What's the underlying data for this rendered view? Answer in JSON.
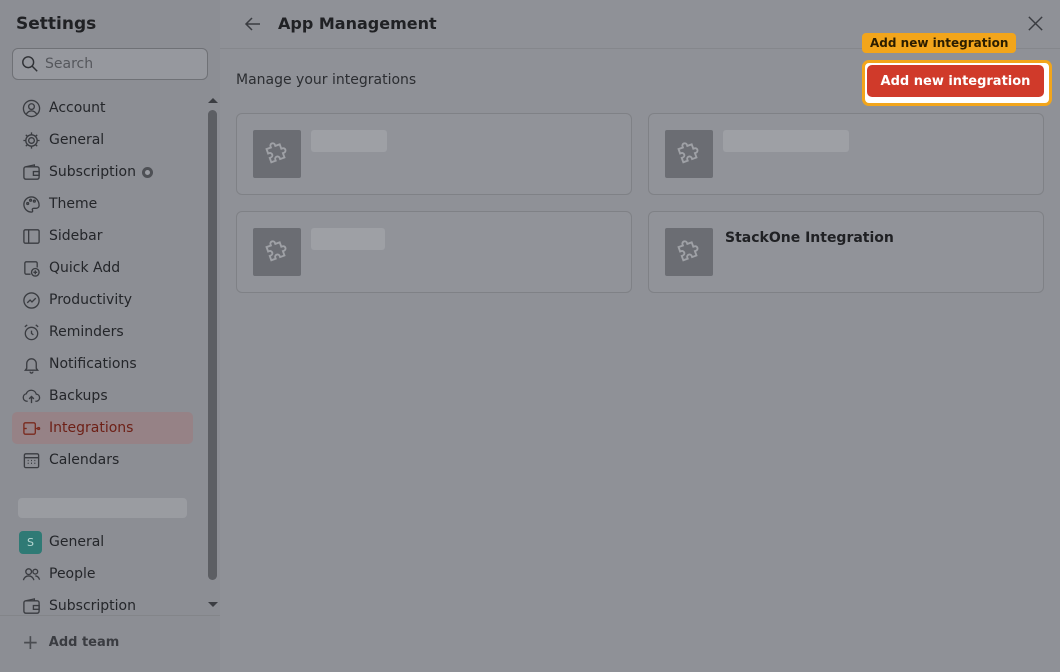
{
  "sidebar": {
    "title": "Settings",
    "search_placeholder": "Search",
    "items": [
      {
        "label": "Account",
        "icon": "user-circle-icon"
      },
      {
        "label": "General",
        "icon": "gear-icon"
      },
      {
        "label": "Subscription",
        "icon": "wallet-icon"
      },
      {
        "label": "Theme",
        "icon": "palette-icon"
      },
      {
        "label": "Sidebar",
        "icon": "sidebar-icon"
      },
      {
        "label": "Quick Add",
        "icon": "quick-add-icon"
      },
      {
        "label": "Productivity",
        "icon": "productivity-icon"
      },
      {
        "label": "Reminders",
        "icon": "alarm-clock-icon"
      },
      {
        "label": "Notifications",
        "icon": "bell-icon"
      },
      {
        "label": "Backups",
        "icon": "cloud-upload-icon"
      },
      {
        "label": "Integrations",
        "icon": "integrations-icon",
        "active": true
      },
      {
        "label": "Calendars",
        "icon": "calendar-icon"
      }
    ],
    "team_items": [
      {
        "label": "General",
        "avatar": "S"
      },
      {
        "label": "People",
        "icon": "people-icon"
      },
      {
        "label": "Subscription",
        "icon": "wallet-icon"
      }
    ],
    "add_team_label": "Add team"
  },
  "header": {
    "title": "App Management"
  },
  "main": {
    "subtitle": "Manage your integrations",
    "add_button_label": "Add new integration",
    "tooltip_label": "Add new integration",
    "cards": [
      {
        "title": ""
      },
      {
        "title": ""
      },
      {
        "title": ""
      },
      {
        "title": "StackOne Integration"
      }
    ]
  },
  "colors": {
    "accent": "#d03a2a",
    "highlight": "#f2a51b",
    "team_avatar": "#2f7a75"
  }
}
